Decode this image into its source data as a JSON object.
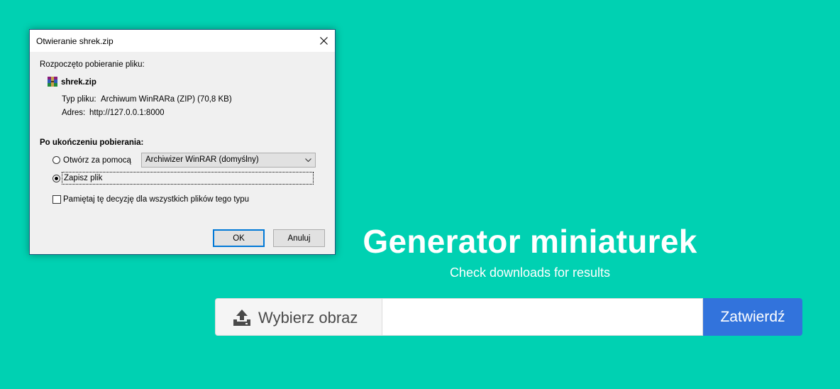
{
  "dialog": {
    "title": "Otwieranie shrek.zip",
    "intro": "Rozpoczęto pobieranie pliku:",
    "file_name": "shrek.zip",
    "file_icon": "winrar-archive-icon",
    "type_label": "Typ pliku:",
    "type_value": "Archiwum WinRARa (ZIP) (70,8 KB)",
    "address_label": "Adres:",
    "address_value": "http://127.0.0.1:8000",
    "after_heading": "Po ukończeniu pobierania:",
    "open_with_label": "Otwórz za pomocą",
    "open_with_selected": "Archiwizer WinRAR (domyślny)",
    "save_file_label": "Zapisz plik",
    "selected_option": "save",
    "remember_label": "Pamiętaj tę decyzję dla wszystkich plików tego typu",
    "remember_checked": false,
    "ok_label": "OK",
    "cancel_label": "Anuluj"
  },
  "page": {
    "title": "Generator miniaturek",
    "subtitle": "Check downloads for results",
    "choose_label": "Wybierz obraz",
    "upload_icon": "upload-icon",
    "file_name_value": "",
    "submit_label": "Zatwierdź"
  },
  "colors": {
    "background": "#00D1B2",
    "submit_button": "#3273DC",
    "focus_border": "#0078D7"
  }
}
